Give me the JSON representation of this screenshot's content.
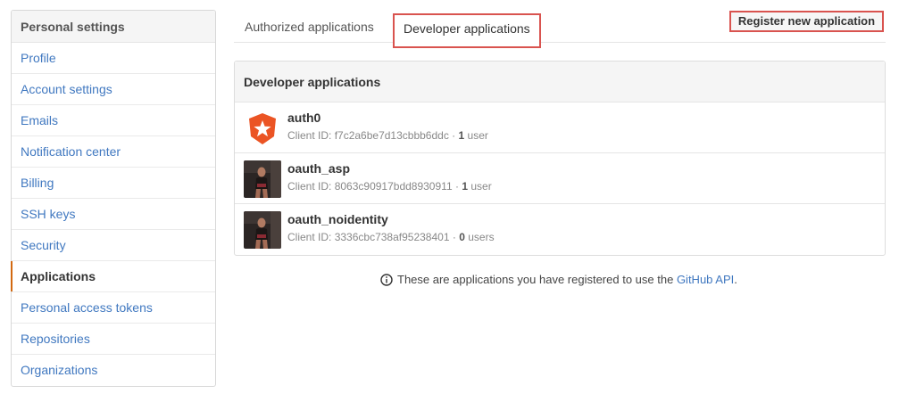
{
  "sidebar": {
    "title": "Personal settings",
    "items": [
      {
        "label": "Profile",
        "selected": false
      },
      {
        "label": "Account settings",
        "selected": false
      },
      {
        "label": "Emails",
        "selected": false
      },
      {
        "label": "Notification center",
        "selected": false
      },
      {
        "label": "Billing",
        "selected": false
      },
      {
        "label": "SSH keys",
        "selected": false
      },
      {
        "label": "Security",
        "selected": false
      },
      {
        "label": "Applications",
        "selected": true
      },
      {
        "label": "Personal access tokens",
        "selected": false
      },
      {
        "label": "Repositories",
        "selected": false
      },
      {
        "label": "Organizations",
        "selected": false
      }
    ]
  },
  "tabs": {
    "authorized": "Authorized applications",
    "developer": "Developer applications"
  },
  "register_button": "Register new application",
  "apps_panel": {
    "title": "Developer applications",
    "apps": [
      {
        "name": "auth0",
        "client_id_label": "Client ID:",
        "client_id": "f7c2a6be7d13cbbb6ddc",
        "separator": "·",
        "user_count": "1",
        "user_label": "user",
        "avatar": "auth0-logo-icon"
      },
      {
        "name": "oauth_asp",
        "client_id_label": "Client ID:",
        "client_id": "8063c90917bdd8930911",
        "separator": "·",
        "user_count": "1",
        "user_label": "user",
        "avatar": "user-photo-icon"
      },
      {
        "name": "oauth_noidentity",
        "client_id_label": "Client ID:",
        "client_id": "3336cbc738af95238401",
        "separator": "·",
        "user_count": "0",
        "user_label": "users",
        "avatar": "user-photo-icon"
      }
    ]
  },
  "note": {
    "text": "These are applications you have registered to use the",
    "link": "GitHub API",
    "end": "."
  },
  "colors": {
    "link": "#4078c0",
    "highlight_border": "#d9534f",
    "selected_accent": "#d26911",
    "auth0_orange": "#eb5424"
  }
}
